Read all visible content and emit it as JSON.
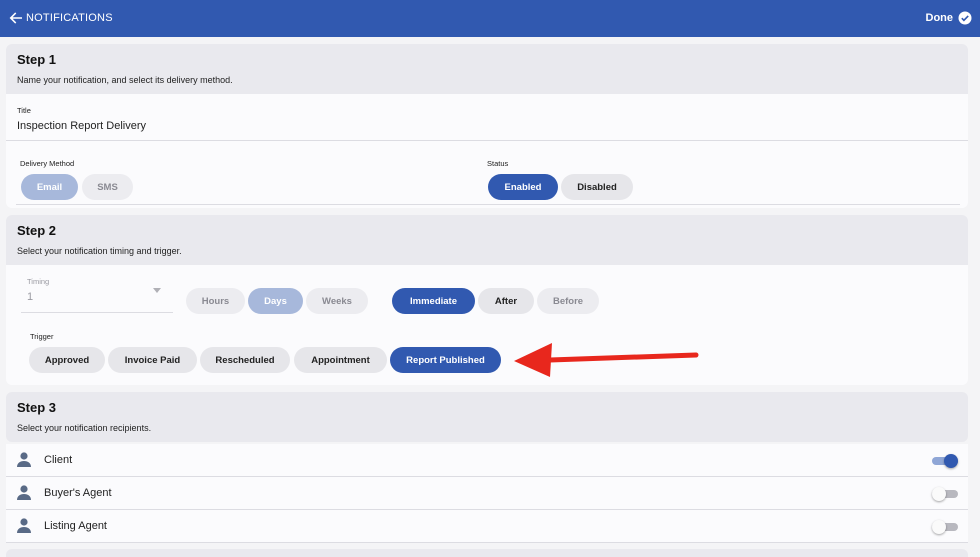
{
  "header": {
    "title": "NOTIFICATIONS",
    "done_label": "Done"
  },
  "step1": {
    "heading": "Step 1",
    "subtitle": "Name your notification, and select its delivery method.",
    "title_label": "Title",
    "title_value": "Inspection Report Delivery",
    "delivery_label": "Delivery Method",
    "delivery_options": [
      "Email",
      "SMS"
    ],
    "delivery_selected": "Email",
    "status_label": "Status",
    "status_options": [
      "Enabled",
      "Disabled"
    ],
    "status_selected": "Enabled"
  },
  "step2": {
    "heading": "Step 2",
    "subtitle": "Select your notification timing and trigger.",
    "timing_label": "Timing",
    "timing_value": "1",
    "units": [
      "Hours",
      "Days",
      "Weeks"
    ],
    "unit_selected": "Days",
    "when": [
      "Immediate",
      "After",
      "Before"
    ],
    "when_selected": "Immediate",
    "trigger_label": "Trigger",
    "triggers": [
      "Approved",
      "Invoice Paid",
      "Rescheduled",
      "Appointment",
      "Report Published"
    ],
    "trigger_selected": "Report Published"
  },
  "step3": {
    "heading": "Step 3",
    "subtitle": "Select your notification recipients.",
    "recipients": [
      {
        "name": "Client",
        "enabled": true
      },
      {
        "name": "Buyer's Agent",
        "enabled": false
      },
      {
        "name": "Listing Agent",
        "enabled": false
      }
    ]
  },
  "colors": {
    "primary": "#3159b0",
    "annotation_arrow": "#e8271d"
  },
  "icons": {
    "back": "arrow-left-icon",
    "done": "check-circle-icon",
    "person": "person-icon",
    "dropdown": "caret-down-icon"
  }
}
